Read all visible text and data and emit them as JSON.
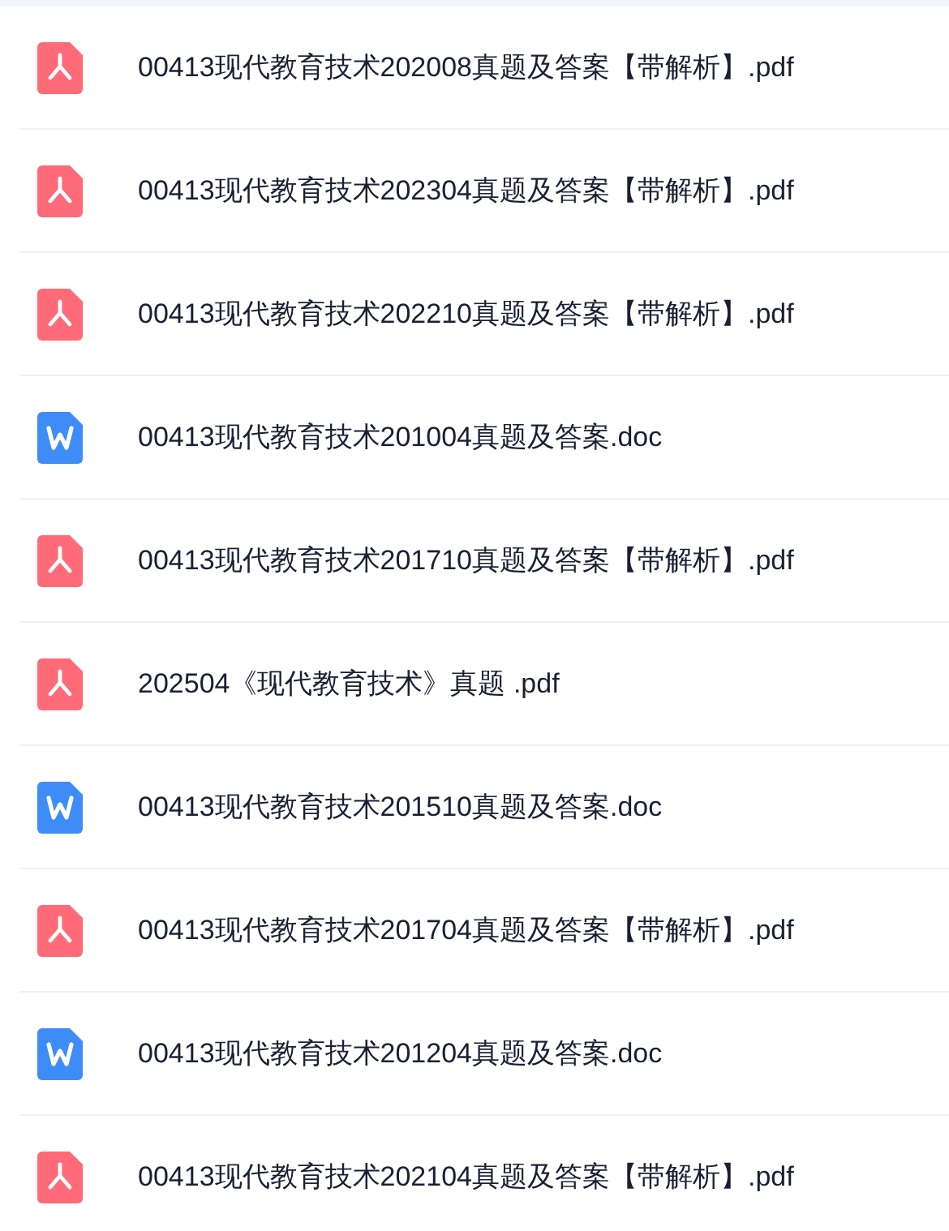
{
  "files": [
    {
      "kind": "pdf",
      "name": "00413现代教育技术202008真题及答案【带解析】.pdf"
    },
    {
      "kind": "pdf",
      "name": "00413现代教育技术202304真题及答案【带解析】.pdf"
    },
    {
      "kind": "pdf",
      "name": "00413现代教育技术202210真题及答案【带解析】.pdf"
    },
    {
      "kind": "doc",
      "name": "00413现代教育技术201004真题及答案.doc"
    },
    {
      "kind": "pdf",
      "name": "00413现代教育技术201710真题及答案【带解析】.pdf"
    },
    {
      "kind": "pdf",
      "name": "202504《现代教育技术》真题 .pdf"
    },
    {
      "kind": "doc",
      "name": "00413现代教育技术201510真题及答案.doc"
    },
    {
      "kind": "pdf",
      "name": "00413现代教育技术201704真题及答案【带解析】.pdf"
    },
    {
      "kind": "doc",
      "name": "00413现代教育技术201204真题及答案.doc"
    },
    {
      "kind": "pdf",
      "name": "00413现代教育技术202104真题及答案【带解析】.pdf"
    }
  ]
}
